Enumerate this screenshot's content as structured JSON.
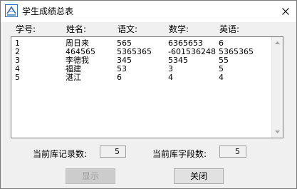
{
  "window": {
    "title": "学生成绩总表",
    "close_glyph": "✕"
  },
  "columns": [
    "学号:",
    "姓名:",
    "语文:",
    "数学:",
    "英语:"
  ],
  "rows": [
    [
      "1",
      "周日来",
      "565",
      "6365653",
      "6"
    ],
    [
      "2",
      "464565",
      "5365365",
      "-601536248",
      "5365365"
    ],
    [
      "3",
      "李德我",
      "345",
      "5345",
      "55"
    ],
    [
      "4",
      "福建",
      "53",
      "3",
      "5"
    ],
    [
      "5",
      "湛江",
      "6",
      "4",
      "4"
    ]
  ],
  "stats": {
    "record_count_label": "当前库记录数:",
    "record_count": "5",
    "field_count_label": "当前库字段数:",
    "field_count": "5"
  },
  "buttons": {
    "show_label": "显示",
    "close_label": "关闭"
  }
}
